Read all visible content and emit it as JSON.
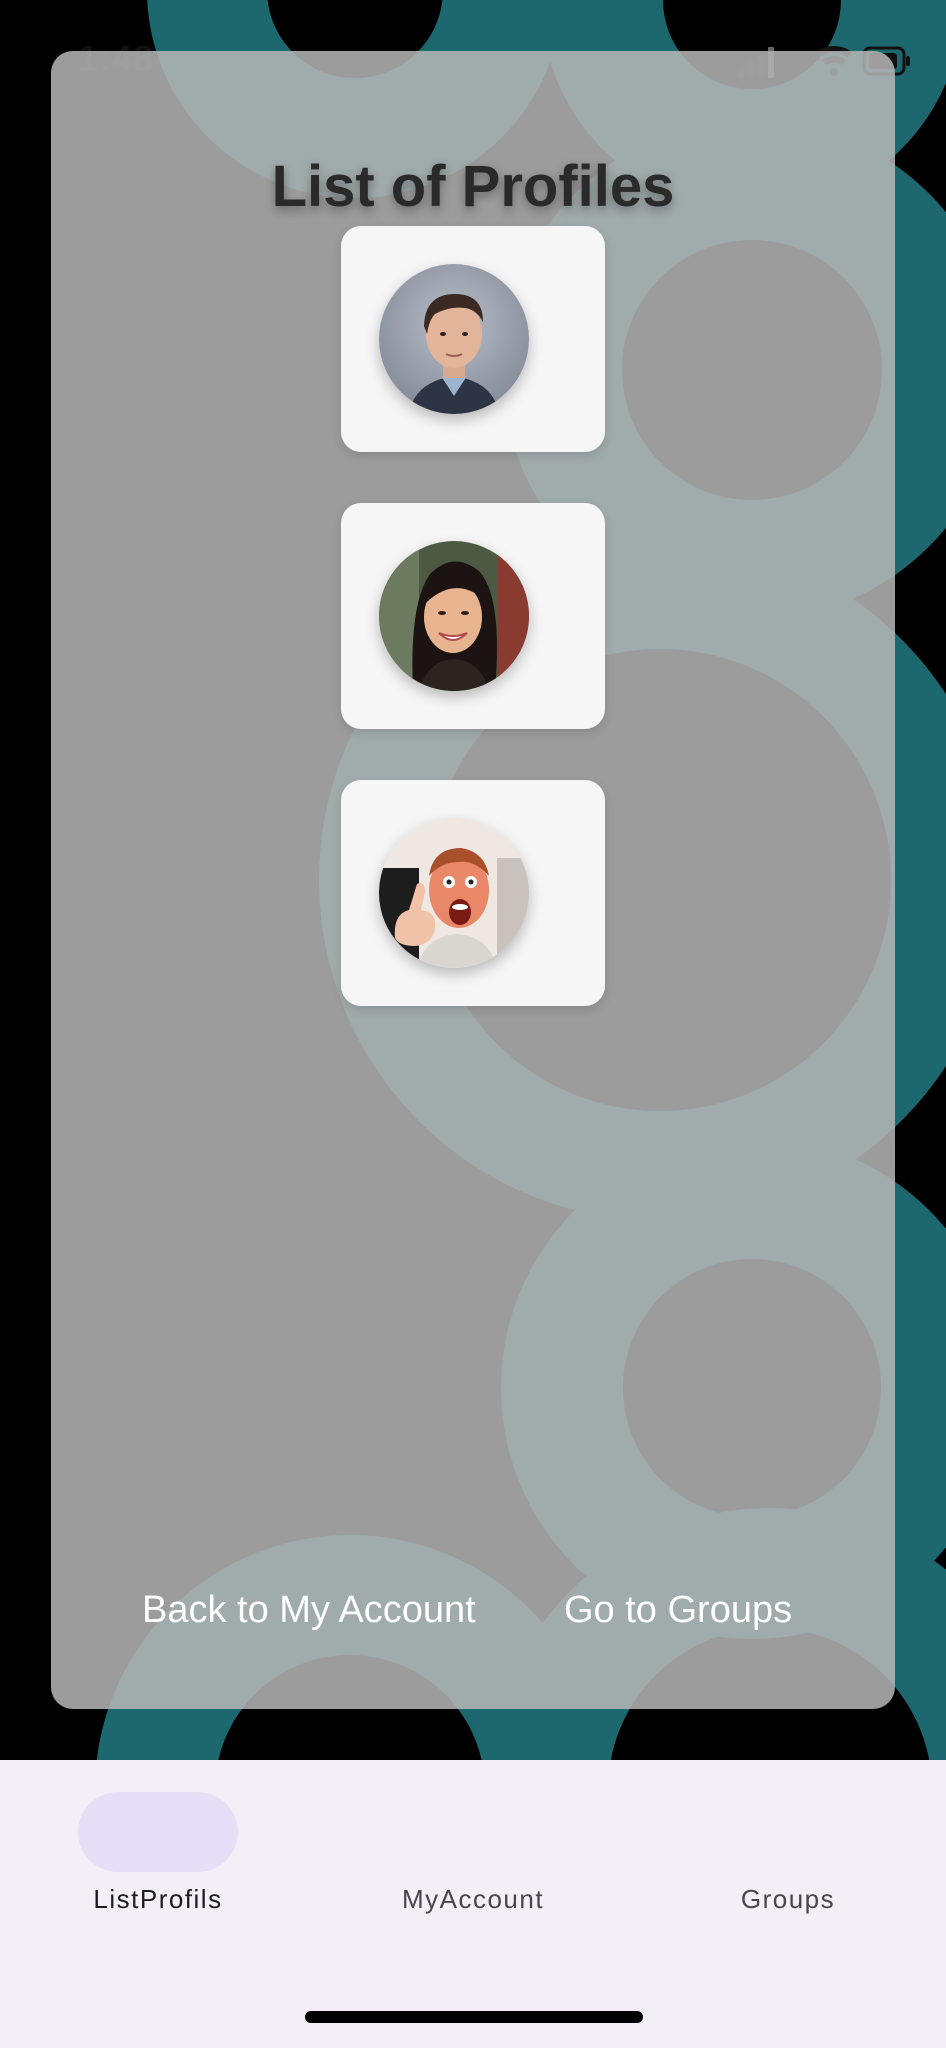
{
  "status_bar": {
    "time": "1:48"
  },
  "page": {
    "title": "List of Profiles"
  },
  "profiles": [
    {
      "avatar_icon": "profile-photo-man-suit"
    },
    {
      "avatar_icon": "profile-photo-woman-smiling"
    },
    {
      "avatar_icon": "profile-photo-man-thumbs-up"
    }
  ],
  "links": {
    "back": "Back to My Account",
    "groups": "Go to Groups"
  },
  "bottom_nav": {
    "items": [
      {
        "label": "ListProfils",
        "active": true
      },
      {
        "label": "MyAccount",
        "active": false
      },
      {
        "label": "Groups",
        "active": false
      }
    ]
  },
  "colors": {
    "background": "#000000",
    "ring": "#1e6e74",
    "card_overlay": "#b6b6b6",
    "nav_background": "#f3eff6",
    "nav_active_pill": "#e7dff7"
  }
}
